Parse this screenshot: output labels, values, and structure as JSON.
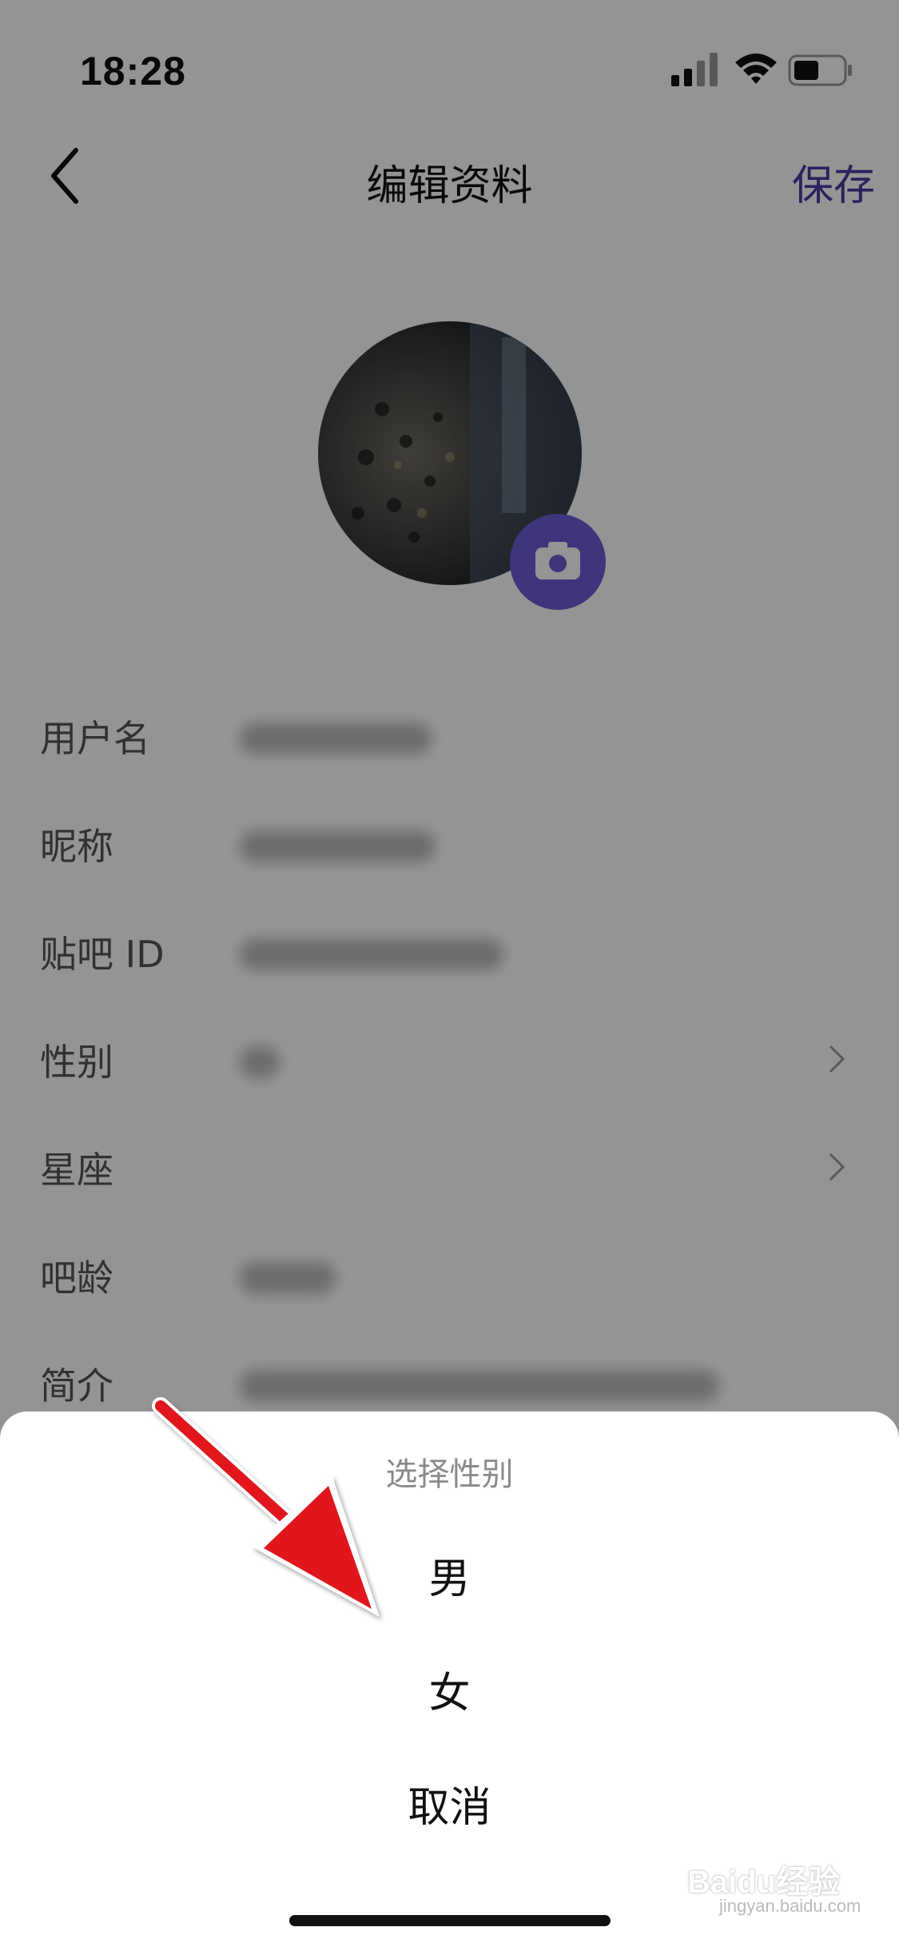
{
  "status_bar": {
    "time": "18:28"
  },
  "header": {
    "title": "编辑资料",
    "save_label": "保存"
  },
  "form": {
    "rows": [
      {
        "label": "用户名",
        "has_arrow": false
      },
      {
        "label": "昵称",
        "has_arrow": false
      },
      {
        "label": "贴吧 ID",
        "has_arrow": false
      },
      {
        "label": "性别",
        "has_arrow": true
      },
      {
        "label": "星座",
        "has_arrow": true
      },
      {
        "label": "吧龄",
        "has_arrow": false
      },
      {
        "label": "简介",
        "has_arrow": false
      }
    ]
  },
  "sheet": {
    "title": "选择性别",
    "options": [
      "男",
      "女"
    ],
    "cancel_label": "取消"
  },
  "watermark": {
    "brand": "Baidu经验",
    "url": "jingyan.baidu.com"
  },
  "colors": {
    "accent": "#4a3aa0",
    "camera_button": "#6b5cd6",
    "annotation": "#e0131b"
  }
}
